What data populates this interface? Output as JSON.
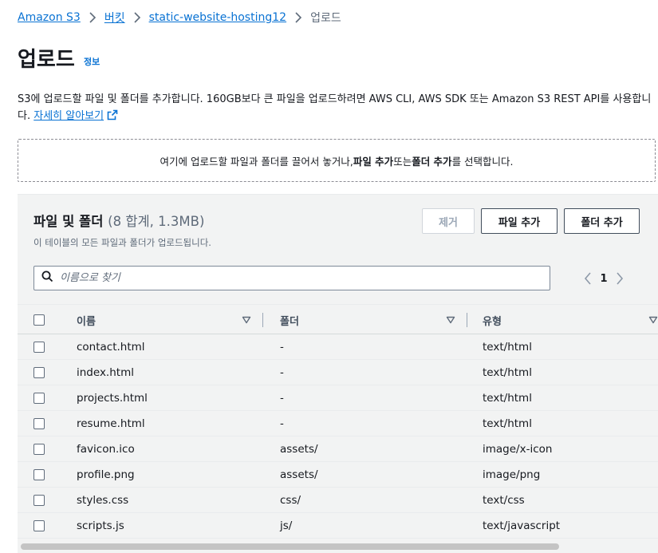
{
  "breadcrumb": {
    "items": [
      {
        "label": "Amazon S3"
      },
      {
        "label": "버킷"
      },
      {
        "label": "static-website-hosting12"
      }
    ],
    "current": "업로드"
  },
  "page": {
    "title": "업로드",
    "info_link": "정보"
  },
  "description": {
    "text_line1": "S3에 업로드할 파일 및 폴더를 추가합니다. 160GB보다 큰 파일을 업로드하려면 AWS CLI, AWS SDK 또는 Amazon S3 REST API를 사용합니",
    "text_line2": "다. ",
    "learn_more": "자세히 알아보기"
  },
  "dropzone": {
    "part1": "여기에 업로드할 파일과 폴더를 끌어서 놓거나, ",
    "add_files": "파일 추가",
    "part2": " 또는 ",
    "add_folder": "폴더 추가",
    "part3": "를 선택합니다."
  },
  "panel": {
    "title": "파일 및 폴더",
    "count": "(8 합계, 1.3MB)",
    "subtitle": "이 테이블의 모든 파일과 폴더가 업로드됩니다.",
    "buttons": {
      "remove": "제거",
      "add_files": "파일 추가",
      "add_folder": "폴더 추가"
    },
    "search": {
      "placeholder": "이름으로 찾기",
      "value": ""
    },
    "pagination": {
      "current_page": "1"
    },
    "table": {
      "columns": [
        "이름",
        "폴더",
        "유형"
      ],
      "rows": [
        {
          "name": "contact.html",
          "folder": "-",
          "type": "text/html"
        },
        {
          "name": "index.html",
          "folder": "-",
          "type": "text/html"
        },
        {
          "name": "projects.html",
          "folder": "-",
          "type": "text/html"
        },
        {
          "name": "resume.html",
          "folder": "-",
          "type": "text/html"
        },
        {
          "name": "favicon.ico",
          "folder": "assets/",
          "type": "image/x-icon"
        },
        {
          "name": "profile.png",
          "folder": "assets/",
          "type": "image/png"
        },
        {
          "name": "styles.css",
          "folder": "css/",
          "type": "text/css"
        },
        {
          "name": "scripts.js",
          "folder": "js/",
          "type": "text/javascript"
        }
      ]
    }
  },
  "colors": {
    "link": "#0972d3",
    "text": "#16191f",
    "muted": "#5f6b7a",
    "panel_bg": "#f2f3f3"
  }
}
